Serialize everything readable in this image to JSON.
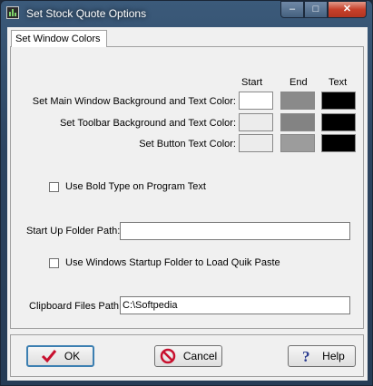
{
  "window": {
    "title": "Set Stock Quote Options"
  },
  "caption_buttons": {
    "minimize": "–",
    "maximize": "□",
    "close": "✕"
  },
  "tab": {
    "label": "Set Window Colors"
  },
  "columns": {
    "start": "Start",
    "end": "End",
    "text": "Text"
  },
  "color_rows": [
    {
      "label": "Set Main Window Background and Text Color:",
      "start": "#ffffff",
      "end": "#8a8a8a",
      "text": "#000000"
    },
    {
      "label": "Set Toolbar Background and Text Color:",
      "start": "#ececec",
      "end": "#838383",
      "text": "#000000"
    },
    {
      "label": "Set Button Text Color:",
      "start": "#ececec",
      "end": "#9c9c9c",
      "text": "#000000"
    }
  ],
  "bold_type": {
    "label": "Use Bold Type on Program Text",
    "checked": false
  },
  "startup_folder": {
    "label": "Start Up Folder Path:",
    "value": ""
  },
  "startup_checkbox": {
    "label": "Use Windows Startup Folder to Load Quik Paste",
    "checked": false
  },
  "clipboard": {
    "label": "Clipboard Files Path:",
    "value": "C:\\Softpedia"
  },
  "buttons": {
    "ok": "OK",
    "cancel": "Cancel",
    "help": "Help"
  },
  "icons": {
    "ok": "checkmark-icon",
    "cancel": "no-entry-icon",
    "help": "question-icon",
    "app": "chart-icon"
  }
}
